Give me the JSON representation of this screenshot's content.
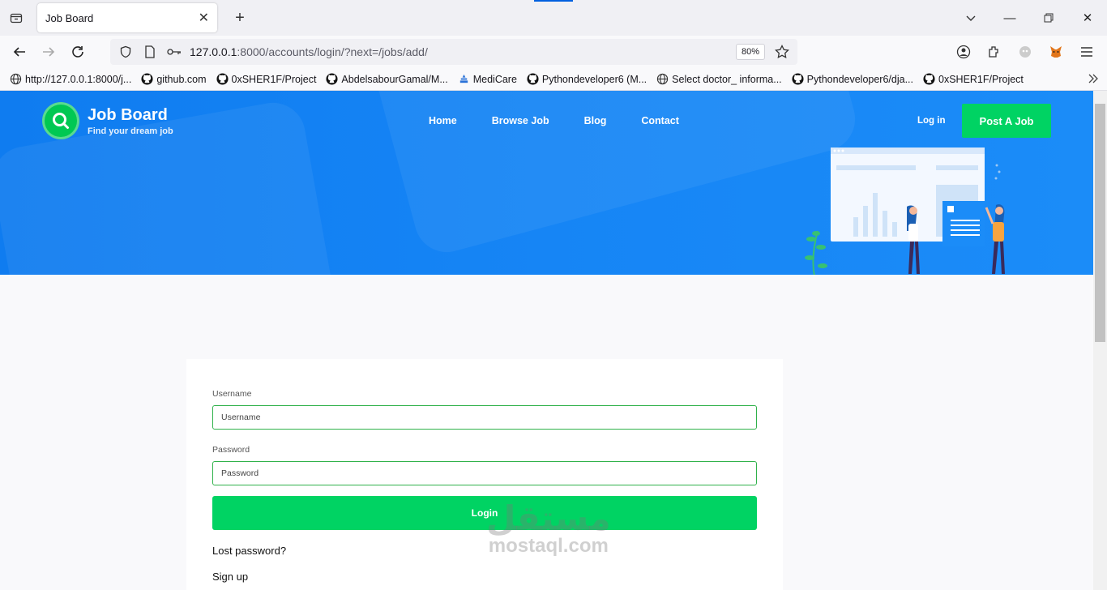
{
  "browser": {
    "tab_title": "Job Board",
    "url_host": "127.0.0.1",
    "url_rest": ":8000/accounts/login/?next=/jobs/add/",
    "zoom": "80%"
  },
  "bookmarks": [
    {
      "label": "http://127.0.0.1:8000/j...",
      "icon": "globe-icon"
    },
    {
      "label": "github.com",
      "icon": "github-icon"
    },
    {
      "label": "0xSHER1F/Project",
      "icon": "github-icon"
    },
    {
      "label": "AbdelsabourGamal/M...",
      "icon": "github-icon"
    },
    {
      "label": "MediCare",
      "icon": "medicare-icon"
    },
    {
      "label": "Pythondeveloper6 (M...",
      "icon": "github-icon"
    },
    {
      "label": "Select doctor_ informa...",
      "icon": "globe-icon"
    },
    {
      "label": "Pythondeveloper6/dja...",
      "icon": "github-icon"
    },
    {
      "label": "0xSHER1F/Project",
      "icon": "github-icon"
    }
  ],
  "site": {
    "logo_title": "Job Board",
    "logo_sub": "Find your dream job",
    "menu": [
      "Home",
      "Browse Job",
      "Blog",
      "Contact"
    ],
    "login_link": "Log in",
    "post_button": "Post A Job"
  },
  "form": {
    "username_label": "Username",
    "username_placeholder": "Username",
    "password_label": "Password",
    "password_placeholder": "Password",
    "login_button": "Login",
    "lost_password": "Lost password?",
    "signup": "Sign up"
  },
  "watermark": {
    "ar": "مستقل",
    "en": "mostaql.com"
  },
  "colors": {
    "hero": "#1685f5",
    "accent_green": "#00d363",
    "input_border": "#2fb14a"
  }
}
